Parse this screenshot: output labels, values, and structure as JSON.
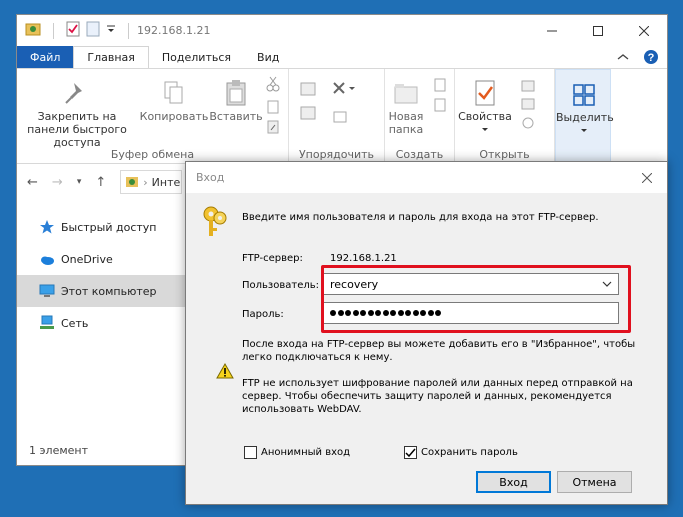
{
  "explorer": {
    "title": "192.168.1.21",
    "tabs": {
      "file": "Файл",
      "home": "Главная",
      "share": "Поделиться",
      "view": "Вид"
    },
    "ribbon": {
      "clipboard": {
        "label": "Буфер обмена",
        "pin": "Закрепить на панели быстрого доступа",
        "copy": "Копировать",
        "paste": "Вставить"
      },
      "organize": {
        "label": "Упорядочить"
      },
      "new": {
        "label": "Создать",
        "new_folder": "Новая папка"
      },
      "open": {
        "label": "Открыть",
        "properties": "Свойства"
      },
      "select": {
        "label": "Выделить"
      }
    },
    "address": {
      "path": "Инте"
    },
    "nav": [
      {
        "label": "Быстрый доступ",
        "icon": "star-icon"
      },
      {
        "label": "OneDrive",
        "icon": "cloud-icon"
      },
      {
        "label": "Этот компьютер",
        "icon": "computer-icon"
      },
      {
        "label": "Сеть",
        "icon": "network-icon"
      }
    ],
    "status": "1 элемент"
  },
  "dialog": {
    "title": "Вход",
    "intro": "Введите имя пользователя и пароль для входа на этот FTP-сервер.",
    "server_label": "FTP-сервер:",
    "server_value": "192.168.1.21",
    "user_label": "Пользователь:",
    "user_value": "recovery",
    "password_label": "Пароль:",
    "password_length": 15,
    "note_favorites_1": "После входа на FTP-сервер вы можете добавить его в \"Избранное\", чтобы",
    "note_favorites_2": "легко подключаться к нему.",
    "warning_1": "FTP не использует шифрование паролей или данных перед отправкой на",
    "warning_2": "сервер. Чтобы обеспечить защиту паролей и данных, рекомендуется",
    "warning_3": "использовать WebDAV.",
    "anonymous_label": "Анонимный вход",
    "anonymous_checked": false,
    "save_password_label": "Сохранить пароль",
    "save_password_checked": true,
    "login_button": "Вход",
    "cancel_button": "Отмена"
  },
  "colors": {
    "accent": "#1a5fb4",
    "highlight": "#e0101e",
    "desktop": "#1f6fb5"
  }
}
